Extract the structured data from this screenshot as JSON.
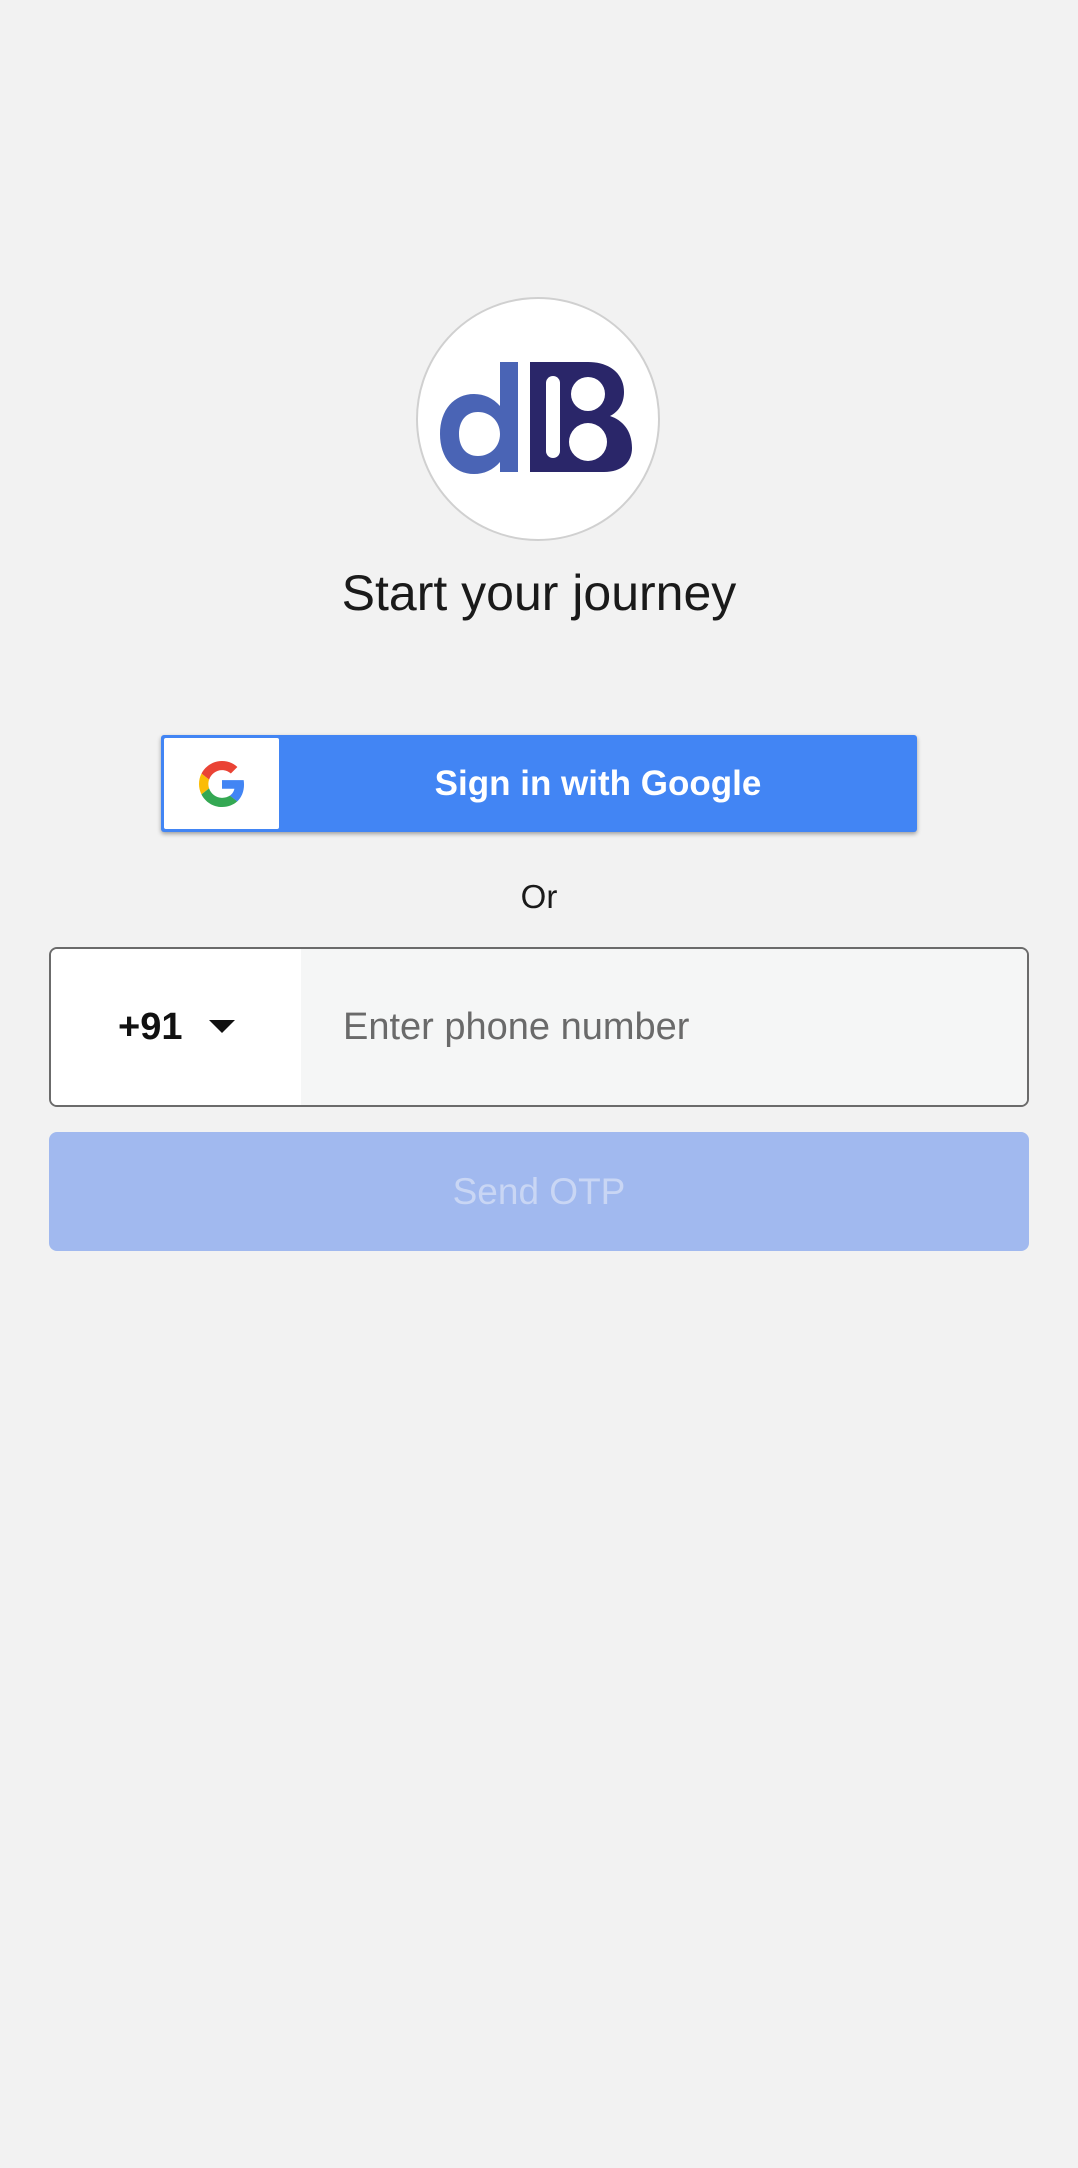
{
  "brand": {
    "logo_text": "dB",
    "logo_colors": {
      "d": "#4a64b5",
      "b": "#2a2669"
    }
  },
  "heading": {
    "title": "Start your journey"
  },
  "google_signin": {
    "label": "Sign in with Google",
    "icon": "google-g-icon",
    "background": "#4285f4"
  },
  "divider": {
    "text": "Or"
  },
  "phone": {
    "country_code": "+91",
    "country_code_icon": "chevron-down-icon",
    "placeholder": "Enter phone number",
    "value": ""
  },
  "send_otp": {
    "label": "Send OTP",
    "enabled": false,
    "background": "#a1b9ef"
  }
}
